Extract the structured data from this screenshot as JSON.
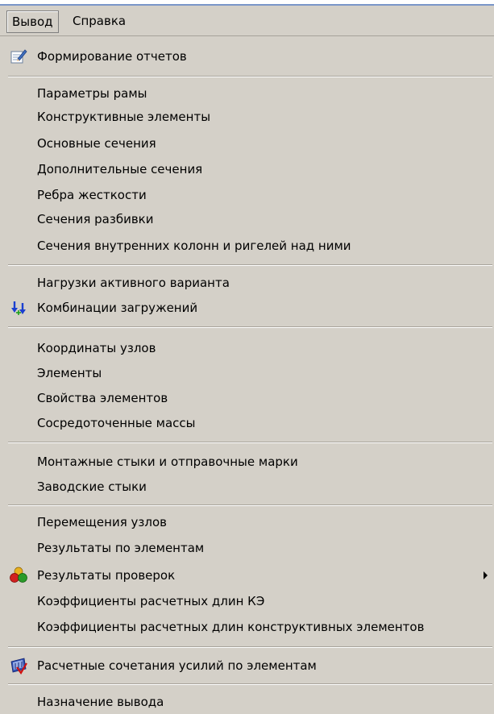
{
  "menubar": {
    "items": [
      "Вывод",
      "Справка"
    ]
  },
  "menu": {
    "report": {
      "label": "Формирование отчетов",
      "icon": "report-edit-icon"
    },
    "frame_params": "Параметры рамы",
    "structural_elements": "Конструктивные элементы",
    "main_sections": "Основные сечения",
    "extra_sections": "Дополнительные сечения",
    "stiffeners": "Ребра жесткости",
    "split_sections": "Сечения разбивки",
    "inner_columns": "Сечения внутренних колонн и ригелей над ними",
    "active_loads": "Нагрузки активного варианта",
    "load_combos": {
      "label": "Комбинации загружений",
      "icon": "load-combination-icon"
    },
    "node_coords": "Координаты узлов",
    "elements": "Элементы",
    "element_props": "Свойства элементов",
    "lumped_masses": "Сосредоточенные массы",
    "assembly_joints": "Монтажные стыки и отправочные марки",
    "factory_joints": "Заводские стыки",
    "node_displacements": "Перемещения узлов",
    "element_results": "Результаты по элементам",
    "check_results": {
      "label": "Результаты проверок",
      "icon": "check-results-icon"
    },
    "fe_length_coeffs": "Коэффициенты расчетных длин КЭ",
    "struct_length_coeffs": "Коэффициенты расчетных длин конструктивных элементов",
    "force_combos": {
      "label": "Расчетные сочетания усилий по элементам",
      "icon": "force-combination-icon"
    },
    "output_destination": "Назначение вывода"
  }
}
